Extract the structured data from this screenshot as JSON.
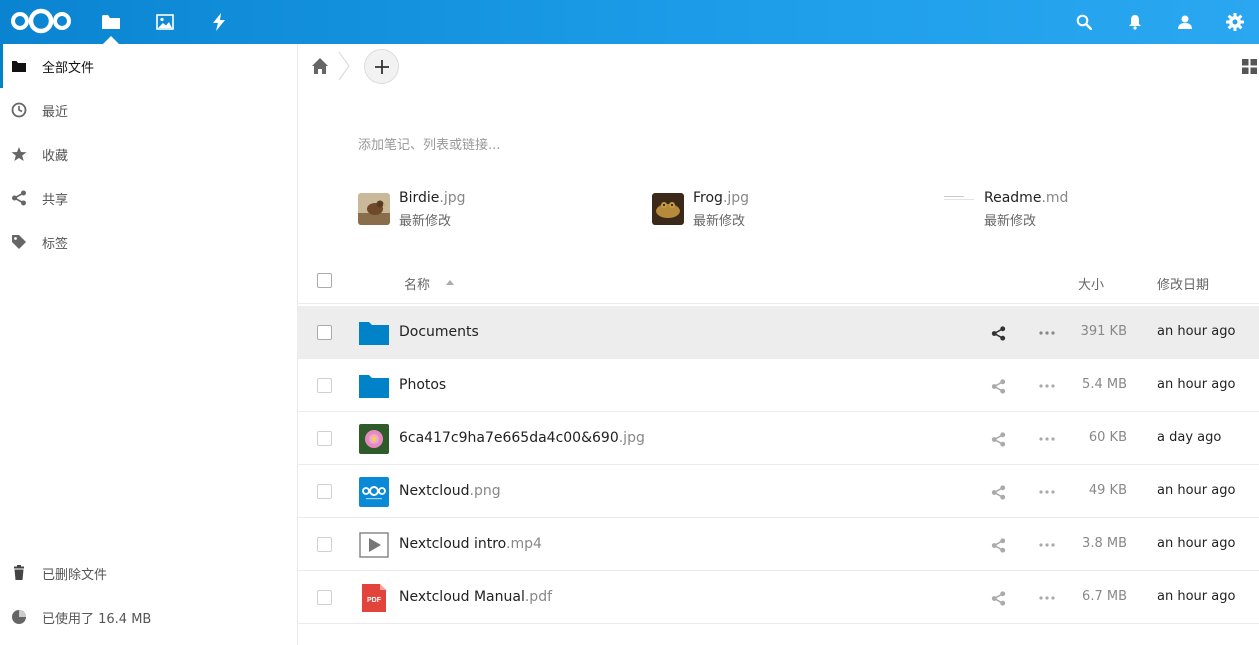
{
  "app": {
    "brand_color": "#0082c9",
    "header_icons": [
      "files-icon",
      "gallery-icon",
      "activity-icon",
      "search-icon",
      "bell-icon",
      "contacts-icon",
      "gear-icon"
    ]
  },
  "sidebar": {
    "items": [
      {
        "label": "全部文件",
        "icon": "folder-icon",
        "active": true
      },
      {
        "label": "最近",
        "icon": "clock-icon",
        "active": false
      },
      {
        "label": "收藏",
        "icon": "star-icon",
        "active": false
      },
      {
        "label": "共享",
        "icon": "share-icon",
        "active": false
      },
      {
        "label": "标签",
        "icon": "tag-icon",
        "active": false
      }
    ],
    "deleted_files": "已删除文件",
    "quota": "已使用了 16.4 MB"
  },
  "main": {
    "notes_placeholder": "添加笔记、列表或链接...",
    "recent": [
      {
        "name": "Birdie",
        "ext": ".jpg",
        "subtitle": "最新修改"
      },
      {
        "name": "Frog",
        "ext": ".jpg",
        "subtitle": "最新修改"
      },
      {
        "name": "Readme",
        "ext": ".md",
        "subtitle": "最新修改"
      }
    ],
    "table": {
      "col_name": "名称",
      "col_size": "大小",
      "col_date": "修改日期",
      "rows": [
        {
          "name": "Documents",
          "ext": "",
          "size": "391 KB",
          "date": "an hour ago",
          "icon": "folder-icon"
        },
        {
          "name": "Photos",
          "ext": "",
          "size": "5.4 MB",
          "date": "an hour ago",
          "icon": "folder-icon"
        },
        {
          "name": "6ca417c9ha7e665da4c00&690",
          "ext": ".jpg",
          "size": "60 KB",
          "date": "a day ago",
          "icon": "flower-thumbnail-icon"
        },
        {
          "name": "Nextcloud",
          "ext": ".png",
          "size": "49 KB",
          "date": "an hour ago",
          "icon": "nextcloud-thumbnail-icon"
        },
        {
          "name": "Nextcloud intro",
          "ext": ".mp4",
          "size": "3.8 MB",
          "date": "an hour ago",
          "icon": "video-icon"
        },
        {
          "name": "Nextcloud Manual",
          "ext": ".pdf",
          "size": "6.7 MB",
          "date": "an hour ago",
          "icon": "pdf-icon"
        }
      ]
    }
  }
}
